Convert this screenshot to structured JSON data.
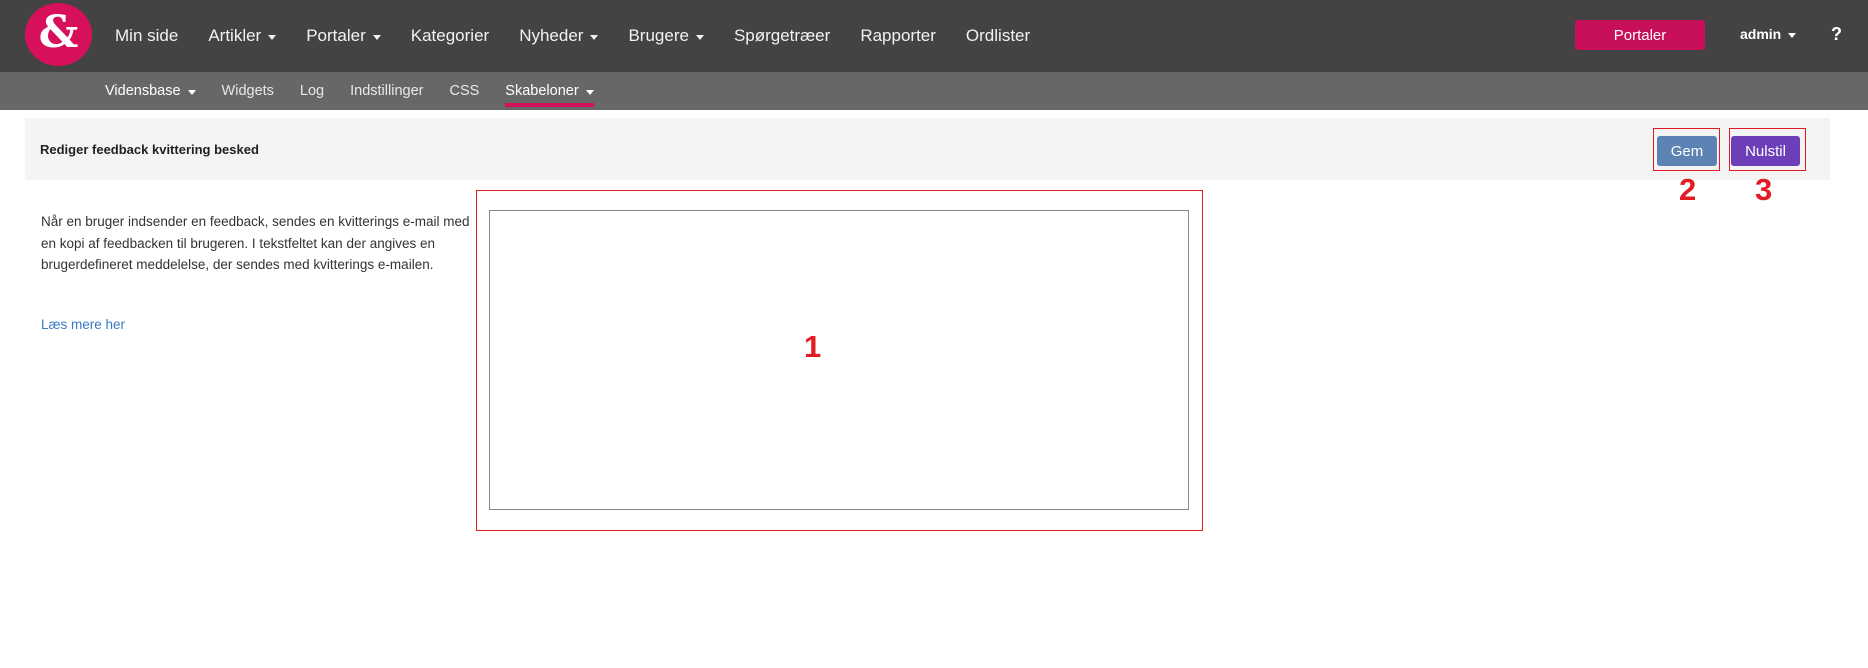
{
  "logo": {
    "glyph": "&",
    "color": "#d6105a"
  },
  "topnav": {
    "items": [
      {
        "label": "Min side",
        "dropdown": false
      },
      {
        "label": "Artikler",
        "dropdown": true
      },
      {
        "label": "Portaler",
        "dropdown": true
      },
      {
        "label": "Kategorier",
        "dropdown": false
      },
      {
        "label": "Nyheder",
        "dropdown": true
      },
      {
        "label": "Brugere",
        "dropdown": true
      },
      {
        "label": "Spørgetræer",
        "dropdown": false
      },
      {
        "label": "Rapporter",
        "dropdown": false
      },
      {
        "label": "Ordlister",
        "dropdown": false
      }
    ],
    "portal_button": "Portaler",
    "user": "admin",
    "help": "?"
  },
  "subnav": {
    "items": [
      {
        "label": "Vidensbase",
        "dropdown": true
      },
      {
        "label": "Widgets",
        "dropdown": false
      },
      {
        "label": "Log",
        "dropdown": false
      },
      {
        "label": "Indstillinger",
        "dropdown": false
      },
      {
        "label": "CSS",
        "dropdown": false
      },
      {
        "label": "Skabeloner",
        "dropdown": true,
        "active": true
      }
    ]
  },
  "panel": {
    "title": "Rediger feedback kvittering besked",
    "save_label": "Gem",
    "reset_label": "Nulstil"
  },
  "description": {
    "text": "Når en bruger indsender en feedback, sendes en kvitterings e-mail med en kopi af feedbacken til brugeren. I tekstfeltet kan der angives en brugerdefineret meddelelse, der sendes med kvitterings e-mailen.",
    "link": "Læs mere her"
  },
  "editor": {
    "value": "",
    "placeholder": ""
  },
  "annotations": {
    "one": "1",
    "two": "2",
    "three": "3"
  },
  "colors": {
    "topbar": "#434343",
    "subbar": "#676767",
    "accent": "#d6105a",
    "save_button": "#5d83b5",
    "reset_button": "#6c3fb8",
    "annotation": "#e31c24"
  }
}
